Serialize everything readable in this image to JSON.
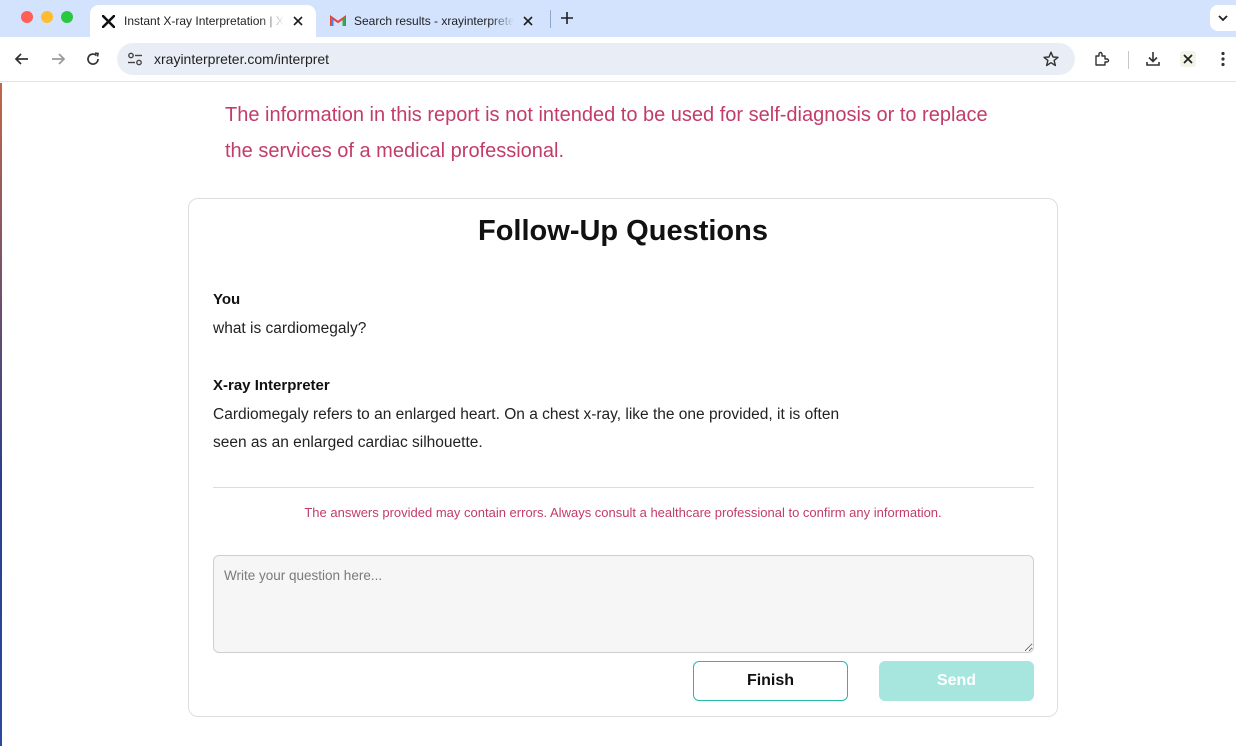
{
  "browser": {
    "tabs": [
      {
        "title": "Instant X-ray Interpretation | X",
        "favicon": "x-logo-icon",
        "active": true
      },
      {
        "title": "Search results - xrayinterpreter",
        "favicon": "gmail-icon",
        "active": false
      }
    ],
    "address": {
      "url": "xrayinterpreter.com/interpret"
    }
  },
  "page": {
    "disclaimer": "The information in this report is not intended to be used for self-diagnosis or to replace the services of a medical professional.",
    "followup": {
      "title": "Follow-Up Questions",
      "messages": [
        {
          "author": "You",
          "text": "what is cardiomegaly?"
        },
        {
          "author": "X-ray Interpreter",
          "text": "Cardiomegaly refers to an enlarged heart. On a chest x-ray, like the one provided, it is often seen as an enlarged cardiac silhouette."
        }
      ],
      "warning": "The answers provided may contain errors. Always consult a healthcare professional to confirm any information.",
      "input": {
        "value": "",
        "placeholder": "Write your question here..."
      },
      "finish_label": "Finish",
      "send_label": "Send"
    }
  },
  "colors": {
    "accent_teal": "#2bb8a8",
    "send_disabled": "#a7e6df",
    "warning_pink": "#c23c6b",
    "chrome_blue": "#d3e3fd"
  }
}
